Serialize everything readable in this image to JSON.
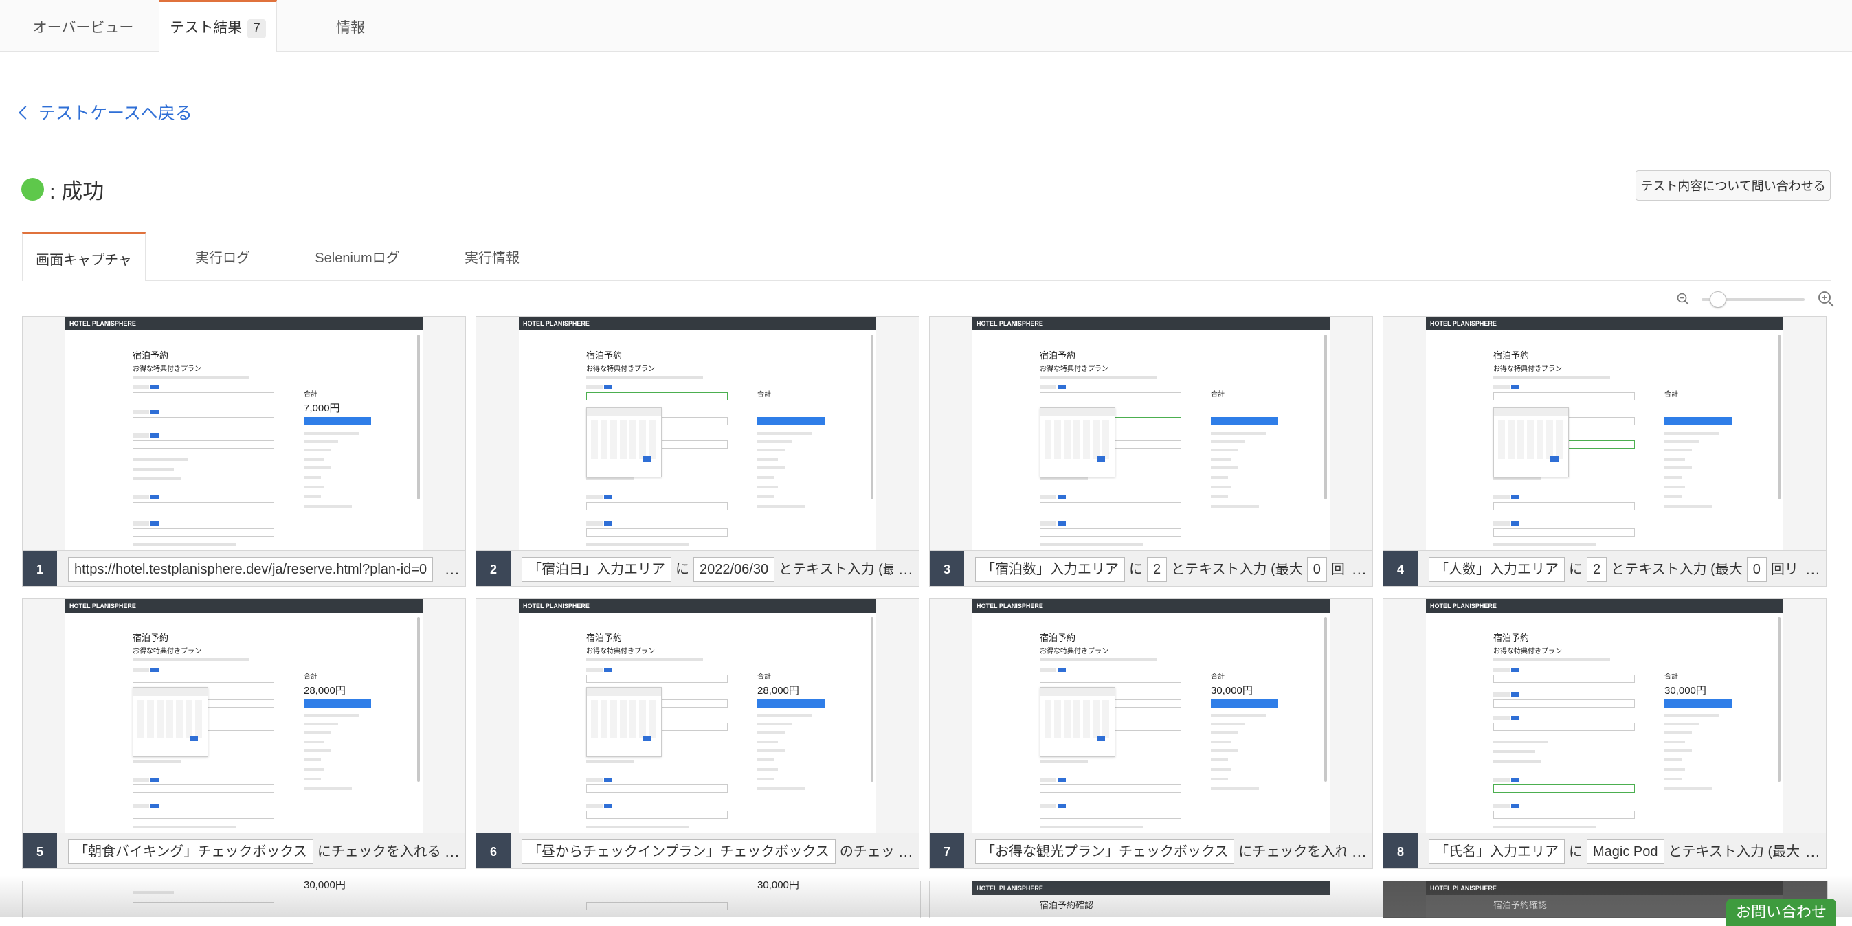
{
  "top_tabs": [
    {
      "label": "オーバービュー"
    },
    {
      "label": "テスト結果",
      "badge": "7"
    },
    {
      "label": "情報"
    }
  ],
  "back_link": "テストケースへ戻る",
  "status": {
    "label": ": 成功",
    "color": "#5ec84b"
  },
  "contact_button": "テスト内容について問い合わせる",
  "sub_tabs": [
    {
      "label": "画面キャプチャ"
    },
    {
      "label": "実行ログ"
    },
    {
      "label": "Seleniumログ"
    },
    {
      "label": "実行情報"
    }
  ],
  "zoom": {
    "level": 0.15
  },
  "mock_app": {
    "header": "HOTEL PLANISPHERE",
    "title": "宿泊予約",
    "plan": "お得な特典付きプラン",
    "total_label": "合計"
  },
  "steps": [
    {
      "num": "1",
      "parts": [
        {
          "t": "https://hotel.testplanisphere.dev/ja/reserve.html?plan-id=0",
          "chip": true
        }
      ],
      "amount": "7,000円"
    },
    {
      "num": "2",
      "parts": [
        {
          "t": "「宿泊日」入力エリア",
          "chip": true
        },
        {
          "t": "に"
        },
        {
          "t": "2022/06/30",
          "chip": true
        },
        {
          "t": "とテキスト入力 (最"
        }
      ],
      "amount": ""
    },
    {
      "num": "3",
      "parts": [
        {
          "t": "「宿泊数」入力エリア",
          "chip": true
        },
        {
          "t": "に"
        },
        {
          "t": "2",
          "chip": true
        },
        {
          "t": "とテキスト入力 (最大"
        },
        {
          "t": "0",
          "chip": true
        },
        {
          "t": "回"
        }
      ],
      "amount": ""
    },
    {
      "num": "4",
      "parts": [
        {
          "t": "「人数」入力エリア",
          "chip": true
        },
        {
          "t": "に"
        },
        {
          "t": "2",
          "chip": true
        },
        {
          "t": "とテキスト入力 (最大"
        },
        {
          "t": "0",
          "chip": true
        },
        {
          "t": "回リ"
        }
      ],
      "amount": ""
    },
    {
      "num": "5",
      "parts": [
        {
          "t": "「朝食バイキング」チェックボックス",
          "chip": true
        },
        {
          "t": "にチェックを入れる"
        }
      ],
      "amount": "28,000円"
    },
    {
      "num": "6",
      "parts": [
        {
          "t": "「昼からチェックインプラン」チェックボックス",
          "chip": true
        },
        {
          "t": "のチェック"
        }
      ],
      "amount": "28,000円"
    },
    {
      "num": "7",
      "parts": [
        {
          "t": "「お得な観光プラン」チェックボックス",
          "chip": true
        },
        {
          "t": "にチェックを入れる"
        }
      ],
      "amount": "30,000円"
    },
    {
      "num": "8",
      "parts": [
        {
          "t": "「氏名」入力エリア",
          "chip": true
        },
        {
          "t": "に"
        },
        {
          "t": "Magic Pod",
          "chip": true
        },
        {
          "t": "とテキスト入力 (最大"
        }
      ],
      "amount": "30,000円"
    }
  ],
  "more_label": "...",
  "bottom_row_amounts": [
    "30,000円",
    "30,000円"
  ],
  "bottom_row_title": "宿泊予約確認",
  "chat_button": "お問い合わせ"
}
